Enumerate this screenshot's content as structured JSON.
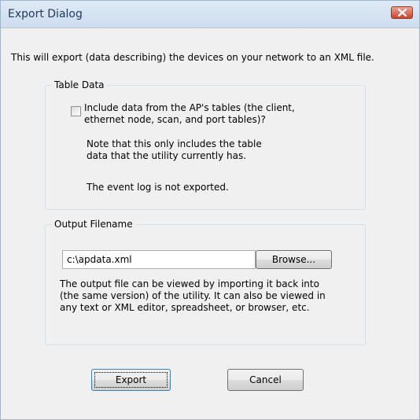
{
  "window": {
    "title": "Export Dialog"
  },
  "intro_text": "This will export (data describing) the devices on your network to an XML file.",
  "table_data": {
    "legend": "Table Data",
    "include_checkbox": {
      "checked": false,
      "label_line1": "Include data from the AP's tables (the client,",
      "label_line2": "ethernet node, scan, and port tables)?"
    },
    "note_line1": "Note that this only includes the table",
    "note_line2": "data that the utility currently has.",
    "event_log_note": "The event log is not exported."
  },
  "output": {
    "legend": "Output Filename",
    "filename_value": "c:\\apdata.xml",
    "browse_label": "Browse...",
    "description_line1": "The output file can be viewed by importing it back into",
    "description_line2": "(the same version) of the utility.  It can also be viewed in",
    "description_line3": "any text or XML editor, spreadsheet, or browser, etc."
  },
  "buttons": {
    "export_label": "Export",
    "cancel_label": "Cancel"
  }
}
